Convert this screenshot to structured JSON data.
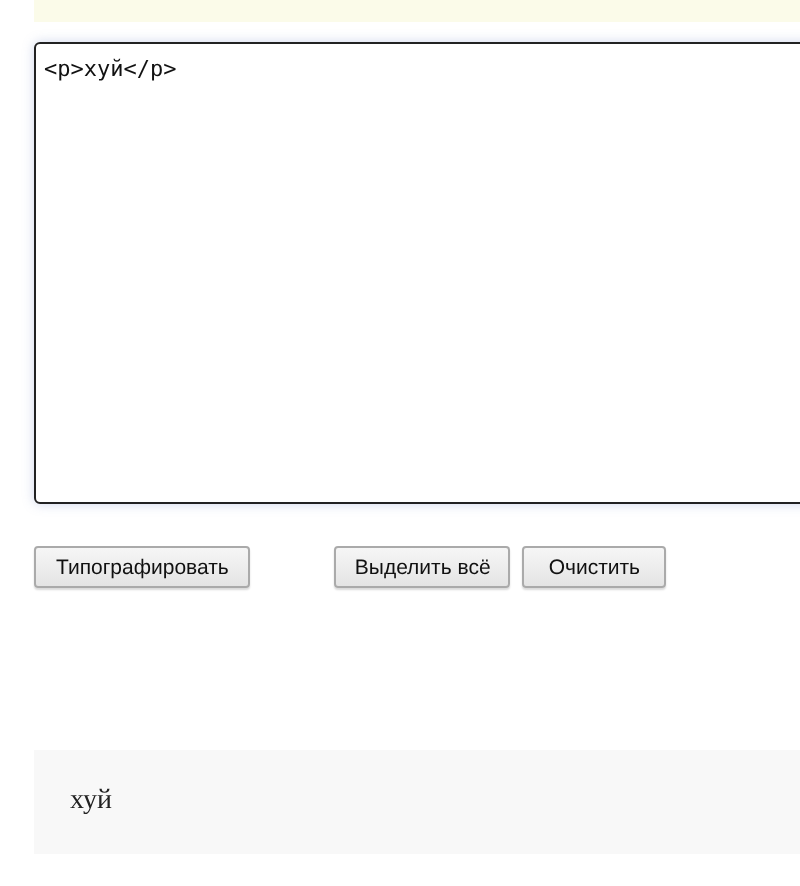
{
  "source": {
    "value": "<p>хуй</p>"
  },
  "buttons": [
    {
      "label": "Типографировать"
    },
    {
      "label": "Выделить всё"
    },
    {
      "label": "Очистить"
    }
  ],
  "result": {
    "text": "хуй"
  }
}
